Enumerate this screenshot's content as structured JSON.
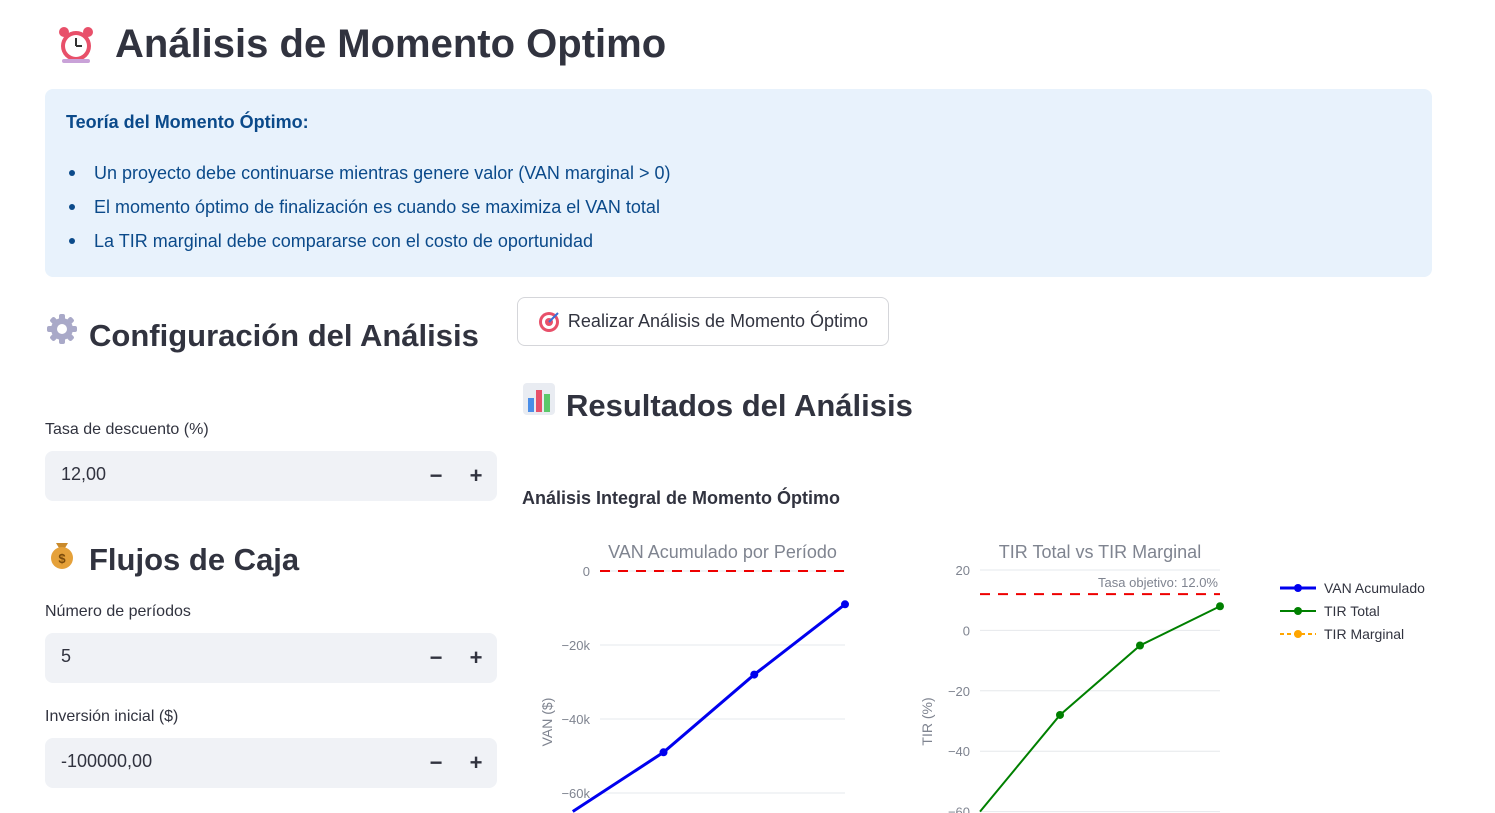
{
  "page": {
    "title": "Análisis de Momento Optimo",
    "title_icon": "alarm-clock-icon"
  },
  "info": {
    "title": "Teoría del Momento Óptimo:",
    "items": [
      "Un proyecto debe continuarse mientras genere valor (VAN marginal > 0)",
      "El momento óptimo de finalización es cuando se maximiza el VAN total",
      "La TIR marginal debe compararse con el costo de oportunidad"
    ]
  },
  "config": {
    "heading": "Configuración del Análisis",
    "heading_icon": "gear-icon",
    "discount_label": "Tasa de descuento (%)",
    "discount_value": "12,00"
  },
  "flows": {
    "heading": "Flujos de Caja",
    "heading_icon": "money-bag-icon",
    "periods_label": "Número de períodos",
    "periods_value": "5",
    "investment_label": "Inversión inicial ($)",
    "investment_value": "-100000,00"
  },
  "stepper": {
    "minus": "−",
    "plus": "+"
  },
  "action": {
    "label": "Realizar Análisis de Momento Óptimo",
    "icon": "target-icon"
  },
  "results": {
    "heading": "Resultados del Análisis",
    "heading_icon": "bar-chart-icon"
  },
  "chart_section": {
    "title": "Análisis Integral de Momento Óptimo"
  },
  "colors": {
    "van": "#0000ee",
    "tir_total": "#008000",
    "tir_marginal": "#ffa500",
    "threshold": "#ee0000",
    "info_bg": "#e8f2fc",
    "info_text": "#0b4a8a"
  },
  "chart_data": [
    {
      "type": "line",
      "title": "VAN Acumulado por Período",
      "ylabel": "VAN ($)",
      "x": [
        1,
        2,
        3,
        4
      ],
      "series": [
        {
          "name": "VAN Acumulado",
          "values": [
            -65000,
            -49000,
            -28000,
            -9000
          ]
        }
      ],
      "reference_line": 0,
      "yticks": [
        0,
        -20000,
        -40000,
        -60000
      ],
      "ytick_labels": [
        "0",
        "−20k",
        "−40k",
        "−60k"
      ],
      "ylim": [
        -62000,
        0
      ]
    },
    {
      "type": "line",
      "title": "TIR Total vs TIR Marginal",
      "ylabel": "TIR (%)",
      "x": [
        1,
        2,
        3,
        4,
        5
      ],
      "series": [
        {
          "name": "TIR Total",
          "values": [
            -60,
            -28,
            -5,
            8
          ]
        },
        {
          "name": "TIR Marginal",
          "values": []
        }
      ],
      "reference_line": 12,
      "reference_label": "Tasa objetivo: 12.0%",
      "yticks": [
        20,
        0,
        -20,
        -40,
        -60
      ],
      "ytick_labels": [
        "20",
        "0",
        "−20",
        "−40",
        "−60"
      ],
      "ylim": [
        -60,
        20
      ]
    }
  ],
  "legend": [
    "VAN Acumulado",
    "TIR Total",
    "TIR Marginal"
  ]
}
